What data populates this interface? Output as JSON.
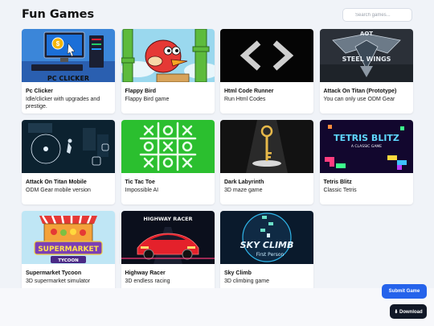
{
  "header": {
    "title": "Fun Games",
    "search_placeholder": "Search games..."
  },
  "games": [
    {
      "name": "Pc Clicker",
      "desc": "Idle/clicker with upgrades and prestige.",
      "thumb_caption": "PC CLICKER"
    },
    {
      "name": "Flappy Bird",
      "desc": "Flappy Bird game"
    },
    {
      "name": "Html Code Runner",
      "desc": "Run Html Codes"
    },
    {
      "name": "Attack On Titan (Prototype)",
      "desc": "You can only use ODM Gear",
      "thumb_caption": "AOT",
      "thumb_sub": "STEEL WINGS"
    },
    {
      "name": "Attack On Titan Mobile",
      "desc": "ODM Gear mobile version"
    },
    {
      "name": "Tic Tac Toe",
      "desc": "Impossible AI"
    },
    {
      "name": "Dark Labyrinth",
      "desc": "3D maze game"
    },
    {
      "name": "Tetris Blitz",
      "desc": "Classic Tetris",
      "thumb_caption": "TETRIS BLITZ",
      "thumb_sub": "A CLASSIC GAME"
    },
    {
      "name": "Supermarket Tycoon",
      "desc": "3D supermarket simulator",
      "thumb_caption": "SUPERMARKET",
      "thumb_sub": "TYCOON"
    },
    {
      "name": "Highway Racer",
      "desc": "3D endless racing",
      "thumb_caption": "HIGHWAY RACER"
    },
    {
      "name": "Sky Climb",
      "desc": "3D climbing game",
      "thumb_caption": "SKY CLIMB",
      "thumb_sub": "First Person"
    }
  ],
  "buttons": {
    "submit_label": "Submit Game",
    "download_label": "⬇ Download"
  },
  "icons": [
    "search-icon",
    "download-icon"
  ]
}
